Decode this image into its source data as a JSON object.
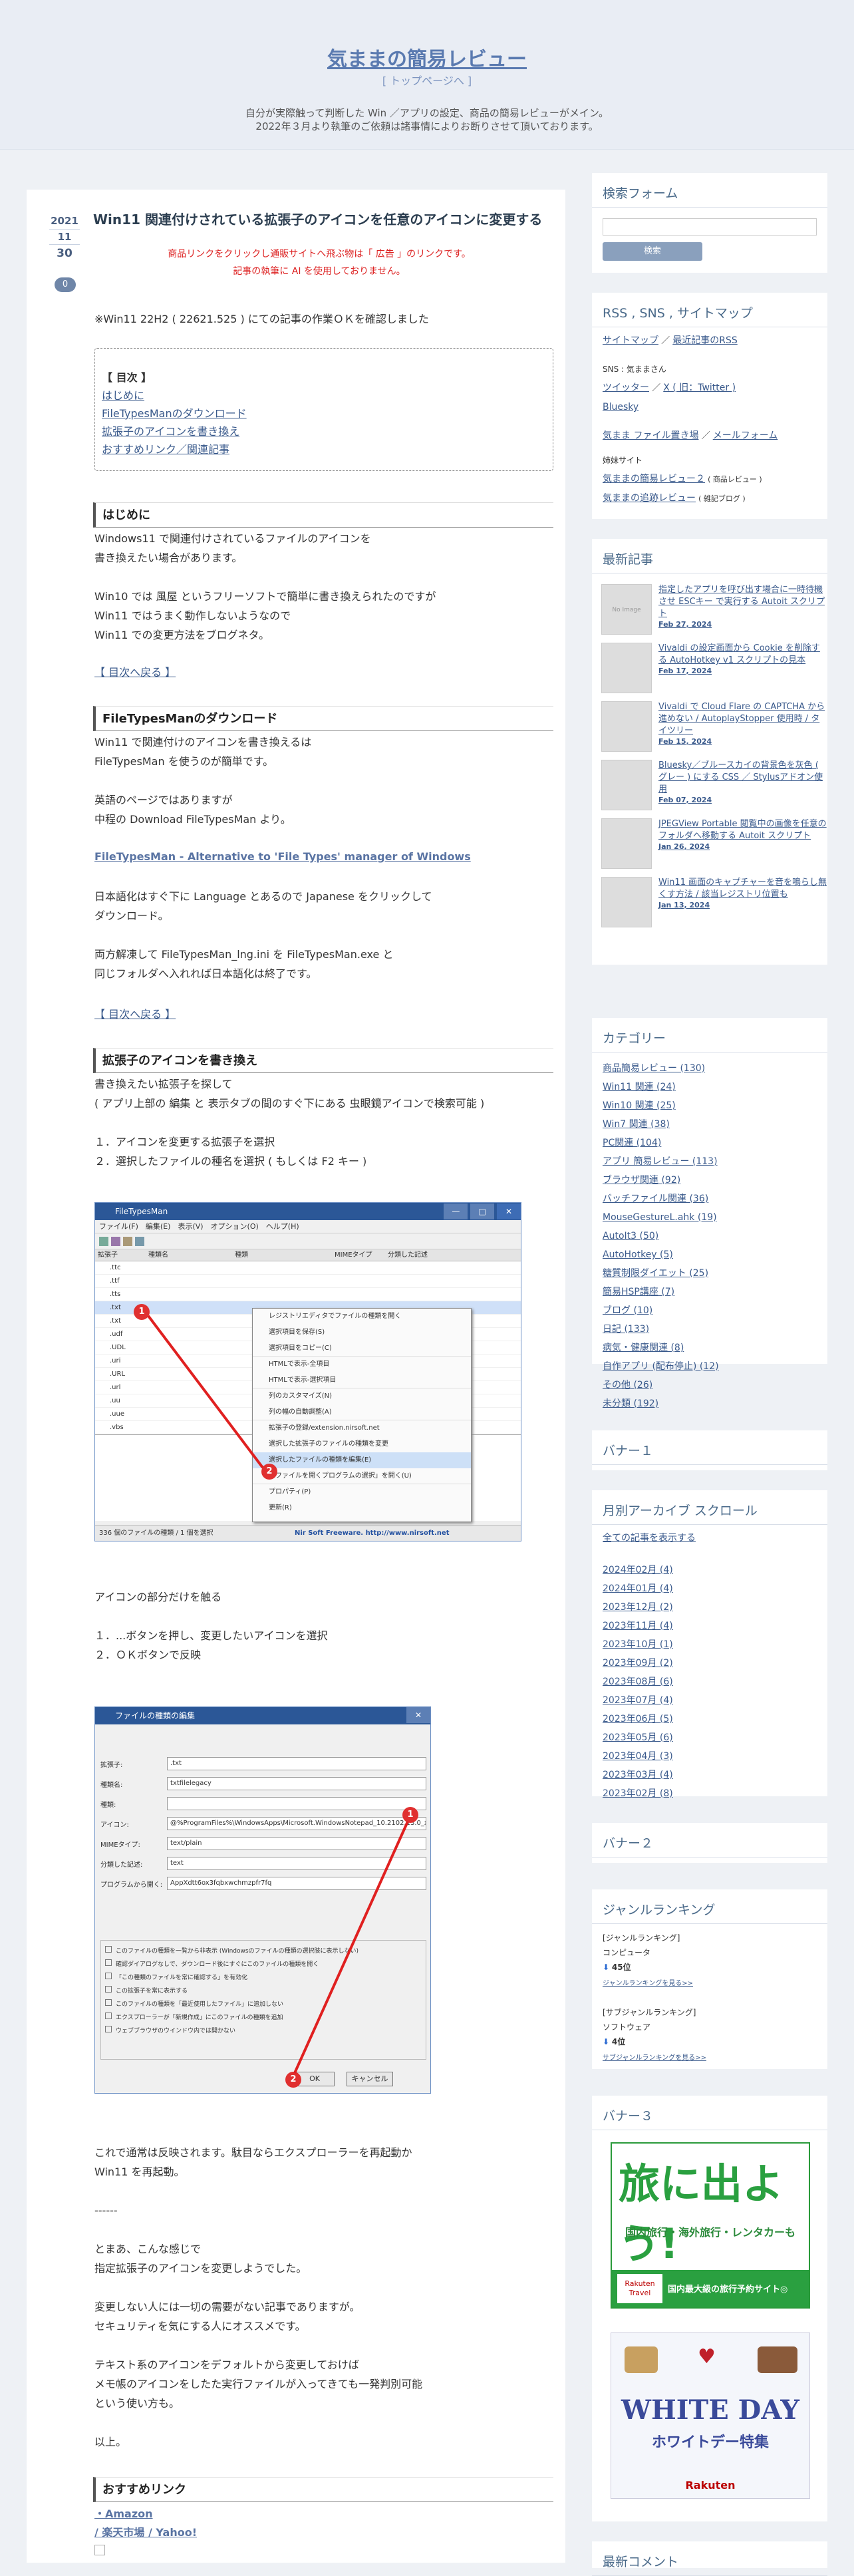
{
  "site": {
    "title": "気ままの簡易レビュー",
    "top_link": "[ トップページへ ]",
    "tagline_1": "自分が実際触って判断した Win ／アプリの設定、商品の簡易レビューがメイン。",
    "tagline_2": "2022年３月より執筆のご依頼は諸事情によりお断りさせて頂いております。"
  },
  "post": {
    "year": "2021",
    "month": "11",
    "day": "30",
    "comments": "0",
    "title": "Win11 関連付けされている拡張子のアイコンを任意のアイコンに変更する",
    "notice_1": "商品リンクをクリックし通販サイトへ飛ぶ物は「 広告 」のリンクです。",
    "notice_2": "記事の執筆に AI を使用しておりません。",
    "intro": "※Win11 22H2 ( 22621.525 ) にての記事の作業ＯＫを確認しました",
    "toc_title": "【 目次 】",
    "toc": [
      "はじめに",
      "FileTypesManのダウンロード",
      "拡張子のアイコンを書き換え",
      "おすすめリンク／関連記事"
    ],
    "h_intro": "はじめに",
    "intro_p1": "Windows11 で関連付けされているファイルのアイコンを",
    "intro_p2": "書き換えたい場合があります。",
    "intro_p3": "Win10 では 風屋 というフリーソフトで簡単に書き換えられたのですが",
    "intro_p4": "Win11 ではうまく動作しないようなので",
    "intro_p5": "Win11 での変更方法をブログネタ。",
    "back_toc": "【 目次へ戻る 】",
    "h_download": "FileTypesManのダウンロード",
    "dl_p1": "Win11 で関連付けのアイコンを書き換えるは",
    "dl_p2": "FileTypesMan を使うのが簡単です。",
    "dl_p3": "英語のページではありますが",
    "dl_p4": "中程の Download FileTypesMan より。",
    "dl_link": "FileTypesMan - Alternative to 'File Types' manager of Windows",
    "dl_p5": "日本語化はすぐ下に Language とあるので Japanese をクリックして",
    "dl_p6": "ダウンロード。",
    "dl_p7": "両方解凍して FileTypesMan_lng.ini を FileTypesMan.exe と",
    "dl_p8": "同じフォルダへ入れれば日本語化は終了です。",
    "h_icon": "拡張子のアイコンを書き換え",
    "ic_p1": "書き換えたい拡張子を探して",
    "ic_p2": "( アプリ上部の 編集 と 表示タブの間のすぐ下にある 虫眼鏡アイコンで検索可能 )",
    "ic_p3": "１．アイコンを変更する拡張子を選択",
    "ic_p4": "２．選択したファイルの種名を選択 ( もしくは F2 キー )",
    "ic_p5": "アイコンの部分だけを触る",
    "ic_p6": "１．...ボタンを押し、変更したいアイコンを選択",
    "ic_p7": "２．ＯＫボタンで反映",
    "end_p1": "これで通常は反映されます。駄目ならエクスプローラーを再起動か",
    "end_p2": "Win11 を再起動。",
    "dashes": "------",
    "end_p3": "とまあ、こんな感じで",
    "end_p4": "指定拡張子のアイコンを変更しようでした。",
    "end_p5": "変更しない人には一切の需要がない記事でありますが。",
    "end_p6": "セキュリティを気にする人にオススメです。",
    "end_p7": "テキスト系のアイコンをデフォルトから変更しておけば",
    "end_p8": "メモ帳のアイコンをしたた実行ファイルが入ってきても一発判別可能",
    "end_p9": "という使い方も。",
    "end_p10": "以上。",
    "h_reco": "おすすめリンク",
    "reco_bullet": "・Amazon",
    "reco_links": "/ 楽天市場 / Yahoo!"
  },
  "screenshot1": {
    "title": "FileTypesMan",
    "menu": "ファイル(F)　編集(E)　表示(V)　オプション(O)　ヘルプ(H)",
    "cols": [
      "拡張子",
      "種類名",
      "種類",
      "MIMEタイプ",
      "分類した記述"
    ],
    "rows": [
      ".ttc",
      ".ttf",
      ".tts",
      ".txt",
      ".txt",
      ".udf",
      ".UDL",
      ".uri",
      ".URL",
      ".url",
      ".uu",
      ".uue",
      ".vbs"
    ],
    "ctx": [
      "レジストリエディタでファイルの種類を開く",
      "選択項目を保存(S)",
      "選択項目をコピー(C)",
      "HTMLで表示-全項目",
      "HTMLで表示-選択項目",
      "列のカスタマイズ(N)",
      "列の幅の自動調整(A)",
      "拡張子の登録/extension.nirsoft.net",
      "選択した拡張子のファイルの種類を変更",
      "選択したファイルの種類を編集(E)",
      "「ファイルを開くプログラムの選択」を開く(U)",
      "プロパティ(P)",
      "更新(R)"
    ],
    "status": "Nir Soft Freeware.  http://www.nirsoft.net",
    "status_left": "336 個のファイルの種類 / 1 個を選択"
  },
  "screenshot2": {
    "title": "ファイルの種類の編集",
    "fields": [
      "拡張子:",
      "種類名:",
      "種類:",
      "アイコン:",
      "MIMEタイプ:",
      "分類した記述:",
      "プログラムから開く:"
    ],
    "values": [
      ".txt",
      "txtfilelegacy",
      "",
      "@%ProgramFiles%\\WindowsApps\\Microsoft.WindowsNotepad_10.2102.13.0_x64__8wek",
      "text/plain",
      "text",
      "AppXdtt6ox3fqbxwchmzpfr7fq"
    ],
    "opts": [
      "このファイルの種類を一覧から非表示 (Windowsのファイルの種類の選択肢に表示しない)",
      "確認ダイアログなしで、ダウンロード後にすぐにこのファイルの種類を開く",
      "「この種類のファイルを常に確認する」を有効化",
      "この拡張子を常に表示する",
      "このファイルの種類を「最近使用したファイル」に追加しない",
      "エクスプローラーが「新規作成」にこのファイルの種類を追加",
      "ウェブブラウザのウインドウ内では開かない"
    ],
    "ok": "OK",
    "cancel": "キャンセル"
  },
  "sidebar": {
    "search_title": "検索フォーム",
    "search_button": "検索",
    "rss_title": "RSS , SNS , サイトマップ",
    "rss_link1": "サイトマップ",
    "rss_link2": "最近記事のRSS",
    "sns_label": "SNS : 気ままさん",
    "tw_link": "ツイッター",
    "x_link": "X ( 旧：Twitter )",
    "bsky_link": "Bluesky",
    "file_link": "気まま ファイル置き場",
    "mail_link": "メールフォーム",
    "sister_label": "姉妹サイト",
    "sister1": "気ままの簡易レビュー２",
    "sister1_note": "( 商品レビュー )",
    "sister2": "気ままの追跡レビュー",
    "sister2_note": "( 雑記ブログ )",
    "recent_title": "最新記事",
    "recent": [
      {
        "title": "指定したアプリを呼び出す場合に一時待機させ ESCキー で実行する Autoit スクリプト",
        "date": "Feb 27, 2024",
        "thumb": "No Image"
      },
      {
        "title": "Vivaldi の設定画面から Cookie を削除する AutoHotkey v1 スクリプトの見本",
        "date": "Feb 17, 2024",
        "thumb": ""
      },
      {
        "title": "Vivaldi で Cloud Flare の CAPTCHA から進めない / AutoplayStopper 使用時 / タイツリー",
        "date": "Feb 15, 2024",
        "thumb": ""
      },
      {
        "title": "Bluesky／ブルースカイの背景色を灰色 ( グレー ) にする CSS ／ Stylusアドオン使用",
        "date": "Feb 07, 2024",
        "thumb": ""
      },
      {
        "title": "JPEGView Portable 閲覧中の画像を任意のフォルダへ移動する Autoit スクリプト",
        "date": "Jan 26, 2024",
        "thumb": ""
      },
      {
        "title": "Win11 画面のキャプチャーを音を鳴らし無くす方法 / 該当レジストリ位置も",
        "date": "Jan 13, 2024",
        "thumb": ""
      }
    ],
    "cat_title": "カテゴリー",
    "categories": [
      "商品簡易レビュー (130)",
      "Win11 関連 (24)",
      "Win10 関連 (25)",
      "Win7 関連 (38)",
      "PC関連 (104)",
      "アプリ 簡易レビュー (113)",
      "ブラウザ関連 (92)",
      "バッチファイル関連 (36)",
      "MouseGestureL.ahk (19)",
      "AutoIt3 (50)",
      "AutoHotkey (5)",
      "糖質制限ダイエット (25)",
      "簡易HSP講座 (7)",
      "ブログ (10)",
      "日記 (133)",
      "病気・健康関連 (8)",
      "自作アプリ (配布停止) (12)",
      "その他 (26)",
      "未分類 (192)"
    ],
    "banner1_title": "バナー１",
    "archive_title": "月別アーカイブ スクロール",
    "archive_all": "全ての記事を表示する",
    "archives": [
      "2024年02月 (4)",
      "2024年01月 (4)",
      "2023年12月 (2)",
      "2023年11月 (4)",
      "2023年10月 (1)",
      "2023年09月 (2)",
      "2023年08月 (6)",
      "2023年07月 (4)",
      "2023年06月 (5)",
      "2023年05月 (6)",
      "2023年04月 (3)",
      "2023年03月 (4)",
      "2023年02月 (8)"
    ],
    "banner2_title": "バナー２",
    "ranking_title": "ジャンルランキング",
    "rank1_genre": "[ジャンルランキング]",
    "rank1_cat": "コンピュータ",
    "rank1_pos": "45位",
    "rank1_link": "ジャンルランキングを見る>>",
    "rank2_genre": "[サブジャンルランキング]",
    "rank2_cat": "ソフトウェア",
    "rank2_pos": "4位",
    "rank2_link": "サブジャンルランキングを見る>>",
    "banner3_title": "バナー３",
    "ad1_big": "旅に出よう!",
    "ad1_sub": "国内旅行・海外旅行・レンタカーも",
    "ad1_foot": "国内最大級の旅行予約サイト◎",
    "ad1_brand": "Rakuten Travel",
    "ad2_big": "WHITE DAY",
    "ad2_sub": "ホワイトデー特集",
    "ad2_brand": "Rakuten",
    "recent_comments_title": "最新コメント"
  }
}
